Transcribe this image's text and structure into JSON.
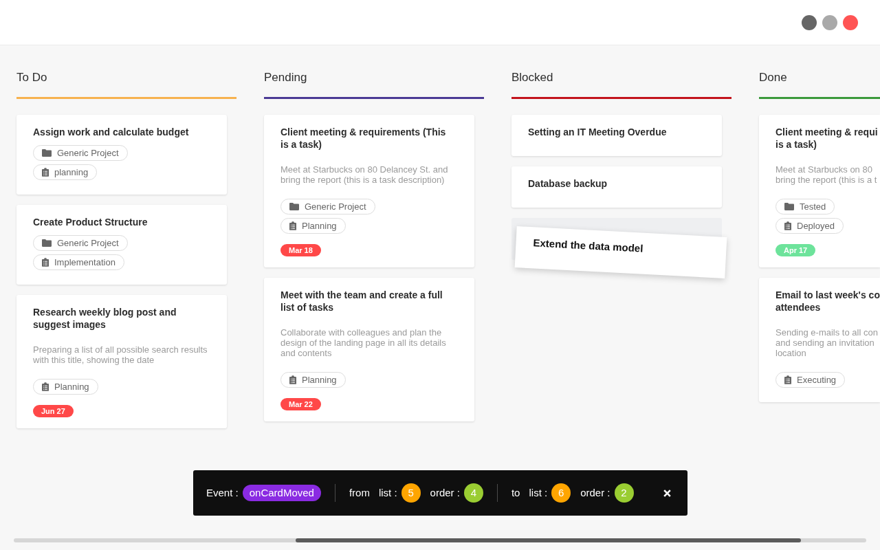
{
  "window_controls": [
    {
      "color": "#666666"
    },
    {
      "color": "#a9a9a9"
    },
    {
      "color": "#ff5454"
    }
  ],
  "columns": [
    {
      "title": "To Do",
      "color": "#f7b24f",
      "clipped": false,
      "cards": [
        {
          "title": "Assign work and calculate budget",
          "dragging": false,
          "tags": [
            {
              "kind": "project",
              "label": "Generic Project"
            },
            {
              "kind": "stage",
              "label": "planning"
            }
          ]
        },
        {
          "title": "Create Product Structure",
          "dragging": false,
          "tags": [
            {
              "kind": "project",
              "label": "Generic Project"
            },
            {
              "kind": "stage",
              "label": "Implementation"
            }
          ]
        },
        {
          "title": "Research weekly blog post and suggest images",
          "dragging": false,
          "description": "Preparing a list of all possible search results with this title, showing the date",
          "tags": [
            {
              "kind": "stage",
              "label": "Planning"
            }
          ],
          "due": {
            "label": "Jun 27",
            "color": "#ff4848"
          }
        }
      ]
    },
    {
      "title": "Pending",
      "color": "#4b3a95",
      "clipped": false,
      "cards": [
        {
          "title": "Client meeting & requirements (This is a task)",
          "dragging": false,
          "description": "Meet at Starbucks on 80 Delancey St. and bring the report (this is a task description)",
          "tags": [
            {
              "kind": "project",
              "label": "Generic Project"
            },
            {
              "kind": "stage",
              "label": "Planning"
            }
          ],
          "due": {
            "label": "Mar 18",
            "color": "#ff4848"
          }
        },
        {
          "title": "Meet with the team and create a full list of tasks",
          "dragging": false,
          "description": "Collaborate with colleagues and plan the design of the landing page in all its details and contents",
          "tags": [
            {
              "kind": "stage",
              "label": "Planning"
            }
          ],
          "due": {
            "label": "Mar 22",
            "color": "#ff4848"
          }
        }
      ]
    },
    {
      "title": "Blocked",
      "color": "#c3141c",
      "clipped": false,
      "cards": [
        {
          "title": "Setting an IT Meeting Overdue",
          "dragging": false
        },
        {
          "title": "Database backup",
          "dragging": false
        },
        {
          "title": "Extend the data model",
          "dragging": true
        }
      ]
    },
    {
      "title": "Done",
      "color": "#3b9a3b",
      "clipped": true,
      "cards": [
        {
          "title": [
            "Client meeting & requi",
            "is a task)"
          ],
          "dragging": false,
          "description": [
            "Meet at Starbucks on 80",
            "bring the report (this is a t"
          ],
          "tags": [
            {
              "kind": "project",
              "label": "Tested"
            },
            {
              "kind": "stage",
              "label": "Deployed"
            }
          ],
          "due": {
            "label": "Apr 17",
            "color": "#6de39b"
          }
        },
        {
          "title": [
            "Email to last week's co",
            "attendees"
          ],
          "dragging": false,
          "description": [
            "Sending e-mails to all con",
            "and sending an invitation",
            "location"
          ],
          "tags": [
            {
              "kind": "stage",
              "label": "Executing"
            }
          ]
        }
      ]
    }
  ],
  "event_bar": {
    "label": "Event :",
    "event_name": "onCardMoved",
    "groups": [
      {
        "label": "from",
        "fields": [
          {
            "label": "list :",
            "value": "5",
            "color": "#ffa500"
          },
          {
            "label": "order :",
            "value": "4",
            "color": "#9acd32"
          }
        ]
      },
      {
        "label": "to",
        "fields": [
          {
            "label": "list :",
            "value": "6",
            "color": "#ffa500"
          },
          {
            "label": "order :",
            "value": "2",
            "color": "#9acd32"
          }
        ]
      }
    ]
  }
}
